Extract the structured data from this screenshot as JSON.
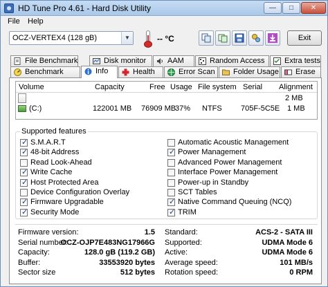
{
  "window": {
    "title": "HD Tune Pro 4.61 - Hard Disk Utility",
    "min": "—",
    "max": "□",
    "close": "✕"
  },
  "menu": {
    "file": "File",
    "help": "Help"
  },
  "toolbar": {
    "drive": "OCZ-VERTEX4        (128 gB)",
    "temperature": "-- °C",
    "exit": "Exit",
    "icons": [
      "copy-icon",
      "copy-alt-icon",
      "save-icon",
      "options-icon",
      "download-icon"
    ]
  },
  "tabs_row1": [
    "File Benchmark",
    "Disk monitor",
    "AAM",
    "Random Access",
    "Extra tests"
  ],
  "tabs_row2": [
    "Benchmark",
    "Info",
    "Health",
    "Error Scan",
    "Folder Usage",
    "Erase"
  ],
  "active_tab": "Info",
  "volumes": {
    "headers": [
      "Volume",
      "Capacity",
      "Free",
      "Usage",
      "File system",
      "Serial",
      "Alignment"
    ],
    "rows": [
      {
        "volume": "",
        "capacity": "",
        "free": "",
        "usage": "",
        "fs": "",
        "serial": "",
        "alignment": "2 MB"
      },
      {
        "volume": "(C:)",
        "capacity": "122001 MB",
        "free": "76909 MB",
        "usage": "37%",
        "fs": "NTFS",
        "serial": "705F-5C5E",
        "alignment": "1 MB"
      }
    ]
  },
  "features": {
    "title": "Supported features",
    "left": [
      {
        "label": "S.M.A.R.T",
        "checked": true
      },
      {
        "label": "48-bit Address",
        "checked": true
      },
      {
        "label": "Read Look-Ahead",
        "checked": false
      },
      {
        "label": "Write Cache",
        "checked": true
      },
      {
        "label": "Host Protected Area",
        "checked": true
      },
      {
        "label": "Device Configuration Overlay",
        "checked": false
      },
      {
        "label": "Firmware Upgradable",
        "checked": true
      },
      {
        "label": "Security Mode",
        "checked": true
      }
    ],
    "right": [
      {
        "label": "Automatic Acoustic Management",
        "checked": false
      },
      {
        "label": "Power Management",
        "checked": true
      },
      {
        "label": "Advanced Power Management",
        "checked": false
      },
      {
        "label": "Interface Power Management",
        "checked": false
      },
      {
        "label": "Power-up in Standby",
        "checked": false
      },
      {
        "label": "SCT Tables",
        "checked": false
      },
      {
        "label": "Native Command Queuing (NCQ)",
        "checked": true
      },
      {
        "label": "TRIM",
        "checked": true
      }
    ]
  },
  "info": {
    "left": [
      {
        "label": "Firmware version:",
        "value": "1.5"
      },
      {
        "label": "Serial number:",
        "value": "OCZ-OJP7E483NG17966G"
      },
      {
        "label": "Capacity:",
        "value": "128.0 gB (119.2 GB)"
      },
      {
        "label": "Buffer:",
        "value": "33553920 bytes"
      },
      {
        "label": "Sector size",
        "value": "512 bytes"
      }
    ],
    "right": [
      {
        "label": "Standard:",
        "value": "ACS-2 - SATA III"
      },
      {
        "label": "Supported:",
        "value": "UDMA Mode 6"
      },
      {
        "label": "Active:",
        "value": "UDMA Mode 6"
      },
      {
        "label": "Average speed:",
        "value": "101 MB/s"
      },
      {
        "label": "Rotation speed:",
        "value": "0 RPM"
      }
    ]
  }
}
